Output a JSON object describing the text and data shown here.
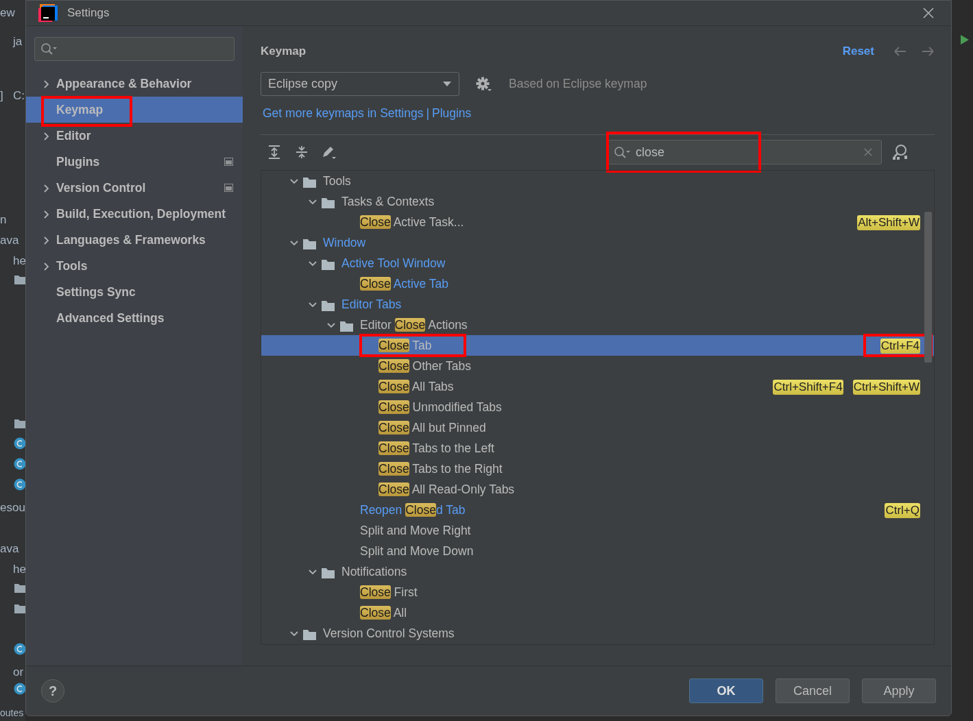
{
  "background_ide": {
    "texts": [
      "ew",
      "ja",
      "]",
      "C:",
      "n",
      "ava",
      "he",
      "esou",
      "ava",
      "he",
      "or",
      "outes"
    ]
  },
  "dialog": {
    "title": "Settings"
  },
  "sidebar": {
    "items": [
      {
        "label": "Appearance & Behavior",
        "expandable": true,
        "selected": false,
        "annotated": false,
        "project_icon": false
      },
      {
        "label": "Keymap",
        "expandable": false,
        "selected": true,
        "annotated": true,
        "project_icon": false
      },
      {
        "label": "Editor",
        "expandable": true,
        "selected": false,
        "annotated": false,
        "project_icon": false
      },
      {
        "label": "Plugins",
        "expandable": false,
        "selected": false,
        "annotated": false,
        "project_icon": true
      },
      {
        "label": "Version Control",
        "expandable": true,
        "selected": false,
        "annotated": false,
        "project_icon": true
      },
      {
        "label": "Build, Execution, Deployment",
        "expandable": true,
        "selected": false,
        "annotated": false,
        "project_icon": false
      },
      {
        "label": "Languages & Frameworks",
        "expandable": true,
        "selected": false,
        "annotated": false,
        "project_icon": false
      },
      {
        "label": "Tools",
        "expandable": true,
        "selected": false,
        "annotated": false,
        "project_icon": false
      },
      {
        "label": "Settings Sync",
        "expandable": false,
        "selected": false,
        "annotated": false,
        "project_icon": false
      },
      {
        "label": "Advanced Settings",
        "expandable": false,
        "selected": false,
        "annotated": false,
        "project_icon": false
      }
    ]
  },
  "panel": {
    "title": "Keymap",
    "reset": "Reset",
    "keymap_select": {
      "value": "Eclipse copy"
    },
    "based_on": "Based on Eclipse keymap",
    "link": "Get more keymaps in Settings",
    "link_separator": "|",
    "link_2": "Plugins",
    "search": {
      "value": "close",
      "annotated": true
    },
    "tree": [
      {
        "kind": "folder",
        "expanded": true,
        "modified": false,
        "selected": false,
        "annotated": false,
        "segments": [
          {
            "text": "Tools",
            "match": false
          }
        ],
        "children": [
          {
            "kind": "folder",
            "expanded": true,
            "modified": false,
            "selected": false,
            "annotated": false,
            "segments": [
              {
                "text": "Tasks & Contexts",
                "match": false
              }
            ],
            "children": [
              {
                "kind": "action",
                "modified": false,
                "selected": false,
                "annotated": false,
                "segments": [
                  {
                    "text": "Close",
                    "match": true
                  },
                  {
                    "text": " Active Task...",
                    "match": false
                  }
                ],
                "shortcuts": [
                  {
                    "text": "Alt+Shift+W",
                    "annotated": false
                  }
                ]
              }
            ]
          }
        ]
      },
      {
        "kind": "folder",
        "expanded": true,
        "modified": true,
        "selected": false,
        "annotated": false,
        "segments": [
          {
            "text": "Window",
            "match": false
          }
        ],
        "children": [
          {
            "kind": "folder",
            "expanded": true,
            "modified": true,
            "selected": false,
            "annotated": false,
            "segments": [
              {
                "text": "Active Tool Window",
                "match": false
              }
            ],
            "children": [
              {
                "kind": "action",
                "modified": true,
                "selected": false,
                "annotated": false,
                "segments": [
                  {
                    "text": "Close",
                    "match": true
                  },
                  {
                    "text": " Active Tab",
                    "match": false
                  }
                ]
              }
            ]
          },
          {
            "kind": "folder",
            "expanded": true,
            "modified": true,
            "selected": false,
            "annotated": false,
            "segments": [
              {
                "text": "Editor Tabs",
                "match": false
              }
            ],
            "children": [
              {
                "kind": "folder",
                "expanded": true,
                "modified": false,
                "selected": false,
                "annotated": false,
                "segments": [
                  {
                    "text": "Editor ",
                    "match": false
                  },
                  {
                    "text": "Close",
                    "match": true
                  },
                  {
                    "text": " Actions",
                    "match": false
                  }
                ],
                "children": [
                  {
                    "kind": "action",
                    "modified": false,
                    "selected": true,
                    "annotated": true,
                    "segments": [
                      {
                        "text": "Close",
                        "match": true
                      },
                      {
                        "text": " Tab",
                        "match": false
                      }
                    ],
                    "shortcuts": [
                      {
                        "text": "Ctrl+F4",
                        "annotated": true
                      }
                    ]
                  },
                  {
                    "kind": "action",
                    "modified": false,
                    "selected": false,
                    "annotated": false,
                    "segments": [
                      {
                        "text": "Close",
                        "match": true
                      },
                      {
                        "text": " Other Tabs",
                        "match": false
                      }
                    ]
                  },
                  {
                    "kind": "action",
                    "modified": false,
                    "selected": false,
                    "annotated": false,
                    "segments": [
                      {
                        "text": "Close",
                        "match": true
                      },
                      {
                        "text": " All Tabs",
                        "match": false
                      }
                    ],
                    "shortcuts": [
                      {
                        "text": "Ctrl+Shift+F4",
                        "annotated": false
                      },
                      {
                        "text": "Ctrl+Shift+W",
                        "annotated": false
                      }
                    ]
                  },
                  {
                    "kind": "action",
                    "modified": false,
                    "selected": false,
                    "annotated": false,
                    "segments": [
                      {
                        "text": "Close",
                        "match": true
                      },
                      {
                        "text": " Unmodified Tabs",
                        "match": false
                      }
                    ]
                  },
                  {
                    "kind": "action",
                    "modified": false,
                    "selected": false,
                    "annotated": false,
                    "segments": [
                      {
                        "text": "Close",
                        "match": true
                      },
                      {
                        "text": " All but Pinned",
                        "match": false
                      }
                    ]
                  },
                  {
                    "kind": "action",
                    "modified": false,
                    "selected": false,
                    "annotated": false,
                    "segments": [
                      {
                        "text": "Close",
                        "match": true
                      },
                      {
                        "text": " Tabs to the Left",
                        "match": false
                      }
                    ]
                  },
                  {
                    "kind": "action",
                    "modified": false,
                    "selected": false,
                    "annotated": false,
                    "segments": [
                      {
                        "text": "Close",
                        "match": true
                      },
                      {
                        "text": " Tabs to the Right",
                        "match": false
                      }
                    ]
                  },
                  {
                    "kind": "action",
                    "modified": false,
                    "selected": false,
                    "annotated": false,
                    "segments": [
                      {
                        "text": "Close",
                        "match": true
                      },
                      {
                        "text": " All Read-Only Tabs",
                        "match": false
                      }
                    ]
                  }
                ]
              },
              {
                "kind": "action",
                "modified": true,
                "selected": false,
                "annotated": false,
                "segments": [
                  {
                    "text": "Reopen ",
                    "match": false
                  },
                  {
                    "text": "Close",
                    "match": true
                  },
                  {
                    "text": "d Tab",
                    "match": false
                  }
                ],
                "shortcuts": [
                  {
                    "text": "Ctrl+Q",
                    "annotated": false
                  }
                ]
              },
              {
                "kind": "action",
                "modified": false,
                "selected": false,
                "annotated": false,
                "segments": [
                  {
                    "text": "Split and Move Right",
                    "match": false
                  }
                ]
              },
              {
                "kind": "action",
                "modified": false,
                "selected": false,
                "annotated": false,
                "segments": [
                  {
                    "text": "Split and Move Down",
                    "match": false
                  }
                ]
              }
            ]
          },
          {
            "kind": "folder",
            "expanded": true,
            "modified": false,
            "selected": false,
            "annotated": false,
            "segments": [
              {
                "text": "Notifications",
                "match": false
              }
            ],
            "children": [
              {
                "kind": "action",
                "modified": false,
                "selected": false,
                "annotated": false,
                "segments": [
                  {
                    "text": "Close",
                    "match": true
                  },
                  {
                    "text": " First",
                    "match": false
                  }
                ]
              },
              {
                "kind": "action",
                "modified": false,
                "selected": false,
                "annotated": false,
                "segments": [
                  {
                    "text": "Close",
                    "match": true
                  },
                  {
                    "text": " All",
                    "match": false
                  }
                ]
              }
            ]
          }
        ]
      },
      {
        "kind": "folder",
        "expanded": true,
        "modified": false,
        "selected": false,
        "annotated": false,
        "segments": [
          {
            "text": "Version Control Systems",
            "match": false
          }
        ]
      }
    ]
  },
  "footer": {
    "help": "?",
    "buttons": [
      {
        "label": "OK",
        "primary": true
      },
      {
        "label": "Cancel",
        "primary": false
      },
      {
        "label": "Apply",
        "primary": false
      }
    ]
  }
}
